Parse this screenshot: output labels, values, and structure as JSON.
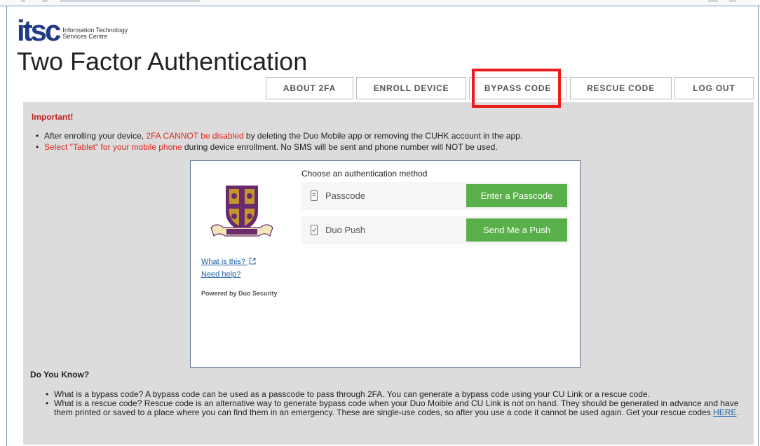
{
  "logo": {
    "mark": "itsc",
    "sub_line1": "Information Technology",
    "sub_line2": "Services Centre"
  },
  "page_title": "Two Factor Authentication",
  "nav": {
    "tabs": [
      {
        "label": "ABOUT 2FA"
      },
      {
        "label": "ENROLL DEVICE"
      },
      {
        "label": "BYPASS CODE",
        "highlighted": true
      },
      {
        "label": "RESCUE CODE"
      },
      {
        "label": "LOG OUT"
      }
    ]
  },
  "important": {
    "heading": "Important!",
    "bullet1_pre": "After enrolling your device, ",
    "bullet1_red": "2FA CANNOT be disabled",
    "bullet1_post": " by deleting the Duo Mobile app or removing the CUHK account in the app.",
    "bullet2_red": "Select \"Tablet\" for your mobile phone",
    "bullet2_post": " during device enrollment. No SMS will be sent and phone number will NOT be used."
  },
  "duo": {
    "what_is_this": "What is this?",
    "need_help": "Need help?",
    "powered_by": "Powered by Duo Security",
    "choose_method": "Choose an authentication method",
    "methods": [
      {
        "label": "Passcode",
        "button": "Enter a Passcode",
        "icon": "passcode-icon"
      },
      {
        "label": "Duo Push",
        "button": "Send Me a Push",
        "icon": "phone-check-icon"
      }
    ]
  },
  "do_you_know": {
    "heading": "Do You Know?",
    "item1": "What is a bypass code? A bypass code can be used as a passcode to pass through 2FA. You can generate a bypass code using your CU Link or a rescue code.",
    "item2": "What is a rescue code? Rescue code is an alternative way to generate bypass code when your Duo Moible and CU Link is not on hand. They should be generated in advance and have them printed or saved to a place where you can find them in an emergency. These are single-use codes, so after you use a code it cannot be used again. Get your rescue codes ",
    "item2_link": "HERE",
    "item2_end": "."
  },
  "colors": {
    "brand_blue": "#1f3a86",
    "alert_red": "#e0271f",
    "button_green": "#59b04a",
    "content_gray": "#dcdcdc",
    "highlight_red": "#ec1c1c"
  }
}
